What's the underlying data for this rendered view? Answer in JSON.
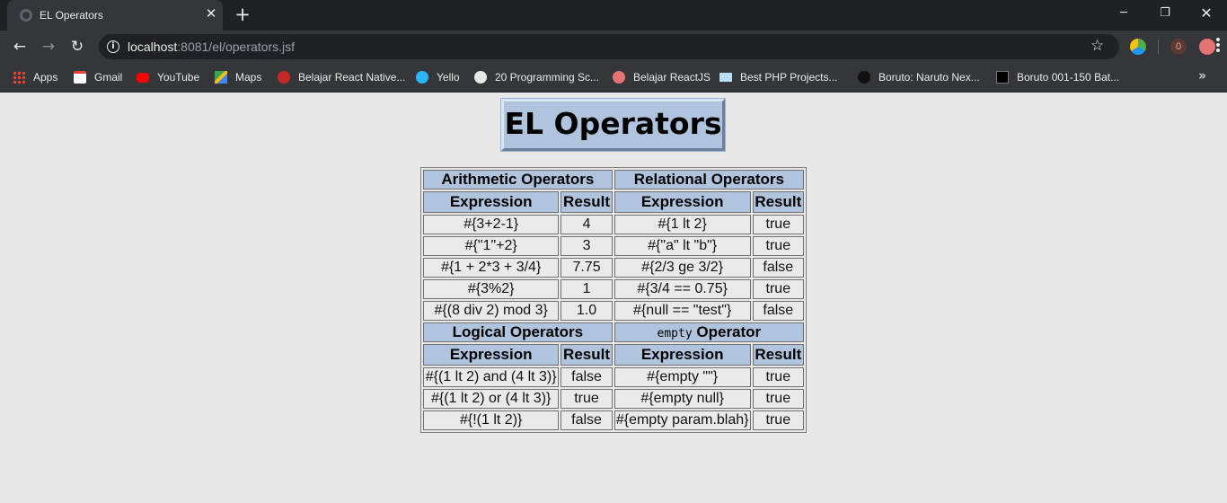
{
  "browser": {
    "tab_title": "EL Operators",
    "url_host": "localhost",
    "url_rest": ":8081/el/operators.jsf",
    "extension_count": "0",
    "bookmarks": [
      {
        "label": "Apps",
        "icon": "apps-grid-icon"
      },
      {
        "label": "Gmail",
        "icon": "gmail-icon"
      },
      {
        "label": "YouTube",
        "icon": "youtube-icon"
      },
      {
        "label": "Maps",
        "icon": "maps-icon"
      },
      {
        "label": "Belajar React Native...",
        "icon": "bookmark-site-icon"
      },
      {
        "label": "Yello",
        "icon": "bookmark-site-icon"
      },
      {
        "label": "20 Programming Sc...",
        "icon": "globe-icon"
      },
      {
        "label": "Belajar ReactJS",
        "icon": "bookmark-site-icon"
      },
      {
        "label": "Best PHP Projects...",
        "icon": "bookmark-site-icon"
      },
      {
        "label": "Boruto: Naruto Nex...",
        "icon": "bookmark-site-icon"
      },
      {
        "label": "Boruto 001-150 Bat...",
        "icon": "bookmark-site-icon"
      }
    ]
  },
  "page": {
    "heading": "EL Operators",
    "col_expression": "Expression",
    "col_result": "Result",
    "sections": {
      "arithmetic": "Arithmetic Operators",
      "relational": "Relational Operators",
      "logical": "Logical Operators",
      "empty_code": "empty",
      "empty_label": " Operator"
    },
    "top_rows": [
      [
        "#{3+2-1}",
        "4",
        "#{1 lt 2}",
        "true"
      ],
      [
        "#{\"1\"+2}",
        "3",
        "#{\"a\" lt \"b\"}",
        "true"
      ],
      [
        "#{1 + 2*3 + 3/4}",
        "7.75",
        "#{2/3 ge 3/2}",
        "false"
      ],
      [
        "#{3%2}",
        "1",
        "#{3/4 == 0.75}",
        "true"
      ],
      [
        "#{(8 div 2) mod 3}",
        "1.0",
        "#{null == \"test\"}",
        "false"
      ]
    ],
    "bottom_rows": [
      [
        "#{(1 lt 2) and (4 lt 3)}",
        "false",
        "#{empty \"\"}",
        "true"
      ],
      [
        "#{(1 lt 2) or (4 lt 3)}",
        "true",
        "#{empty null}",
        "true"
      ],
      [
        "#{!(1 lt 2)}",
        "false",
        "#{empty param.blah}",
        "true"
      ]
    ]
  }
}
